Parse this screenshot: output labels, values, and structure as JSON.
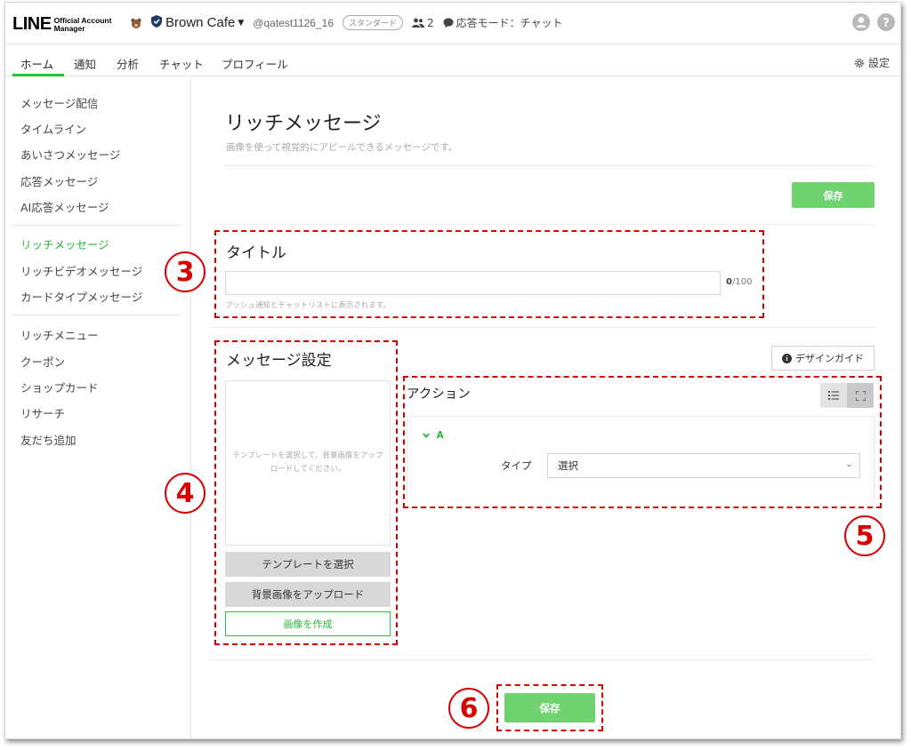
{
  "header": {
    "logo_main": "LINE",
    "logo_sub_line1": "Official Account",
    "logo_sub_line2": "Manager",
    "account_name": "Brown Cafe",
    "account_id": "@qatest1126_16",
    "plan_badge": "スタンダード",
    "member_count": "2",
    "response_mode": "応答モード：チャット"
  },
  "nav": {
    "tabs": [
      {
        "label": "ホーム",
        "active": true
      },
      {
        "label": "通知"
      },
      {
        "label": "分析"
      },
      {
        "label": "チャット"
      },
      {
        "label": "プロフィール"
      }
    ],
    "settings_label": "設定"
  },
  "sidebar": {
    "items": [
      {
        "label": "メッセージ配信"
      },
      {
        "label": "タイムライン"
      },
      {
        "label": "あいさつメッセージ"
      },
      {
        "label": "応答メッセージ"
      },
      {
        "label": "AI応答メッセージ"
      },
      {
        "label": "リッチメッセージ",
        "active": true
      },
      {
        "label": "リッチビデオメッセージ"
      },
      {
        "label": "カードタイプメッセージ"
      },
      {
        "label": "リッチメニュー"
      },
      {
        "label": "クーポン"
      },
      {
        "label": "ショップカード"
      },
      {
        "label": "リサーチ"
      },
      {
        "label": "友だち追加"
      }
    ]
  },
  "main": {
    "page_title": "リッチメッセージ",
    "page_description": "画像を使って視覚的にアピールできるメッセージです。",
    "save_label": "保存",
    "title_section": {
      "heading": "タイトル",
      "input_value": "",
      "counter_current": "0",
      "counter_max": "/100",
      "hint": "プッシュ通知とチャットリストに表示されます。"
    },
    "message_settings": {
      "heading": "メッセージ設定",
      "preview_text": "テンプレートを選択して、背景画像をアップロードしてください。",
      "select_template_label": "テンプレートを選択",
      "upload_background_label": "背景画像をアップロード",
      "create_image_label": "画像を作成"
    },
    "design_guide_label": "デザインガイド",
    "action": {
      "heading": "アクション",
      "area_label": "A",
      "type_label": "タイプ",
      "type_value": "選択"
    }
  },
  "annotations": {
    "markers": [
      "3",
      "4",
      "5",
      "6"
    ],
    "color": "#d80000"
  },
  "colors": {
    "accent_green": "#27c23b",
    "button_green": "#6fd36f"
  }
}
